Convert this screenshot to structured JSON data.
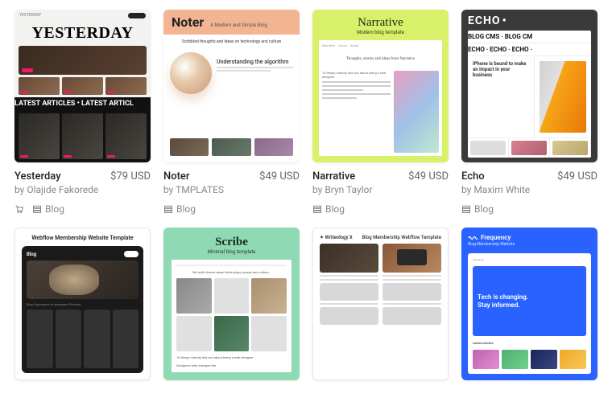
{
  "templates": [
    {
      "title": "Yesterday",
      "price": "$79 USD",
      "author": "by Olajide Fakorede",
      "tags": [
        "Blog"
      ],
      "hasCart": true,
      "thumb": {
        "brand": "YESTERDAY",
        "top_label": "YESTERDAY",
        "marquee": "LATEST ARTICLES • LATEST ARTICL"
      }
    },
    {
      "title": "Noter",
      "price": "$49 USD",
      "author": "by TMPLATES",
      "tags": [
        "Blog"
      ],
      "hasCart": false,
      "thumb": {
        "brand": "Noter",
        "tagline": "A Modern and Simple Blog",
        "caption": "Scribbled thoughts and ideas on technology and culture",
        "article_h": "Understanding the algorithm"
      }
    },
    {
      "title": "Narrative",
      "price": "$49 USD",
      "author": "by Bryn Taylor",
      "tags": [
        "Blog"
      ],
      "hasCart": false,
      "thumb": {
        "brand": "Narrative",
        "tagline": "Modern blog template",
        "center": "Thoughts, stories and ideas from Narrative",
        "listhead": "10 things nobody told you about being a web designer"
      }
    },
    {
      "title": "Echo",
      "price": "$49 USD",
      "author": "by Maxim White",
      "tags": [
        "Blog"
      ],
      "hasCart": false,
      "thumb": {
        "brand": "ECHO",
        "marquee1": "BLOG CMS · BLOG CM",
        "marquee2": "ECHO · ECHO · ECHO ·",
        "hero_h": "iPhone is bound to make an impact in your business"
      }
    },
    {
      "title": "Webflow Membership",
      "thumb": {
        "heading": "Webflow Membership Website Template",
        "blog_label": "Blog",
        "caption": "Blog Experience in Instagram Process"
      }
    },
    {
      "title": "Scribe",
      "thumb": {
        "brand": "Scribe",
        "tagline": "Minimal blog template",
        "txt": "We write stories about technology, people and culture.",
        "txt2": "10 things nobody told you about being a web designer",
        "txt3": "Designers who changed the"
      }
    },
    {
      "title": "Writeology X",
      "thumb": {
        "left": "✦ Writeology X",
        "right": "Blog Membership Webflow Template"
      }
    },
    {
      "title": "Frequency",
      "thumb": {
        "brand": "Frequency",
        "sub": "Blog Membership Website",
        "hero1": "Tech is changing.",
        "hero2": "Stay informed.",
        "label": "Latest articles"
      }
    }
  ]
}
